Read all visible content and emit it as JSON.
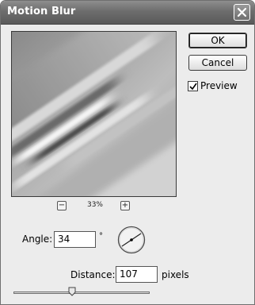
{
  "window": {
    "title": "Motion Blur",
    "close_icon": "close-icon"
  },
  "buttons": {
    "ok_label": "OK",
    "cancel_label": "Cancel"
  },
  "preview_option": {
    "label": "Preview",
    "checked": true
  },
  "zoom": {
    "minus": "−",
    "plus": "+",
    "level": "33%"
  },
  "angle": {
    "label": "Angle:",
    "value": "34",
    "unit": "°"
  },
  "distance": {
    "label": "Distance:",
    "value": "107",
    "unit": "pixels",
    "slider_fraction": 0.43
  },
  "colors": {
    "titlebar": "#6d6d6d",
    "dialog_bg": "#ececec"
  }
}
